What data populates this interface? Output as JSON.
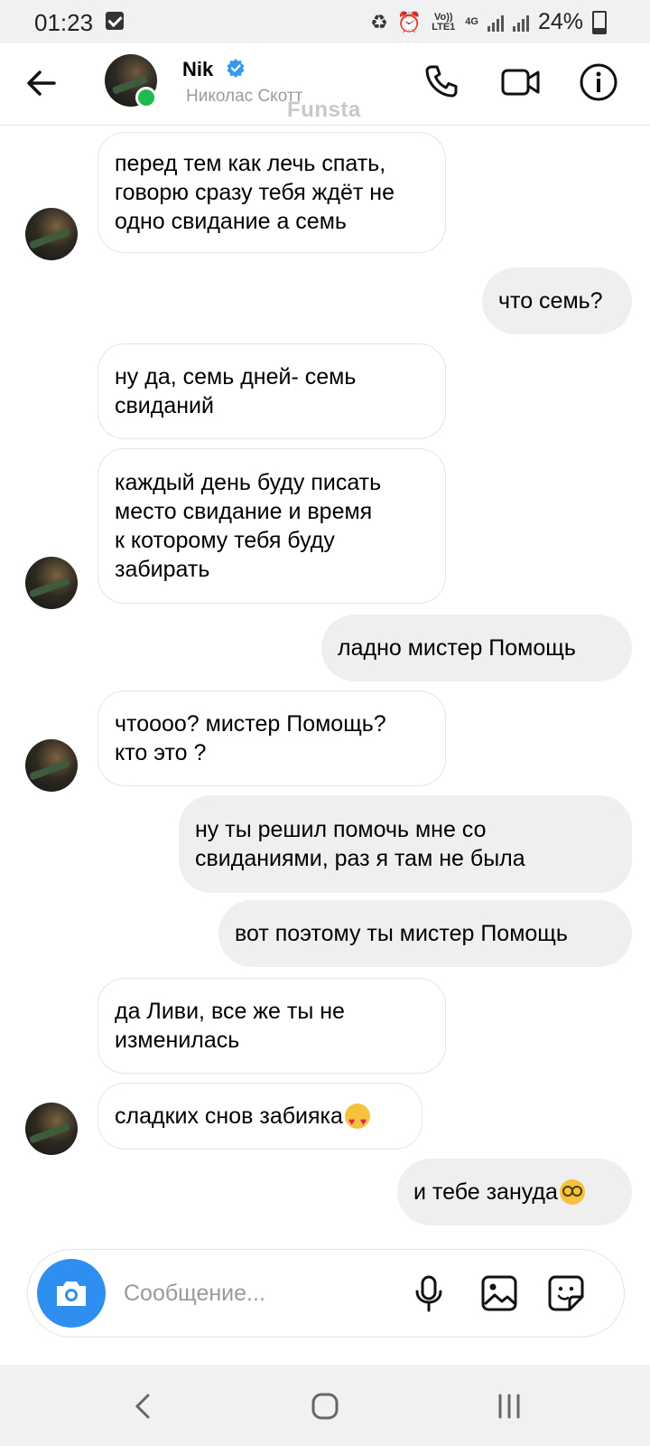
{
  "status_bar": {
    "time": "01:23",
    "volte": "Vo)) LTE1",
    "network": "4G",
    "battery": "24%"
  },
  "header": {
    "name": "Nik",
    "subname": "Николас Скотт",
    "watermark": "Funsta"
  },
  "messages": [
    {
      "dir": "in",
      "text": "перед тем как лечь спать,\nговорю сразу тебя ждёт не\nодно свидание а семь"
    },
    {
      "dir": "out",
      "text": "что семь?"
    },
    {
      "dir": "in",
      "text": "ну да, семь дней- семь\nсвиданий"
    },
    {
      "dir": "in",
      "text": "каждый день буду писать\nместо свидание и время\nк которому тебя буду\nзабирать"
    },
    {
      "dir": "out",
      "text": "ладно мистер Помощь"
    },
    {
      "dir": "in",
      "text": "чтоооо? мистер Помощь?\nкто это ?"
    },
    {
      "dir": "out",
      "text": "ну ты решил помочь мне со\nсвиданиями, раз я там не была"
    },
    {
      "dir": "out",
      "text": "вот поэтому ты мистер Помощь"
    },
    {
      "dir": "in",
      "text": "да Ливи, все же ты не\nизменилась"
    },
    {
      "dir": "in",
      "text": "сладких снов забияка",
      "emoji": "heart-eyes"
    },
    {
      "dir": "out",
      "text": "и тебе зануда ",
      "emoji": "nerd-face"
    }
  ],
  "composer": {
    "placeholder": "Сообщение..."
  },
  "colors": {
    "accent": "#2f8ff0",
    "online": "#1fbb4f",
    "outgoing_bubble": "#efefef",
    "verified": "#3897f0"
  }
}
